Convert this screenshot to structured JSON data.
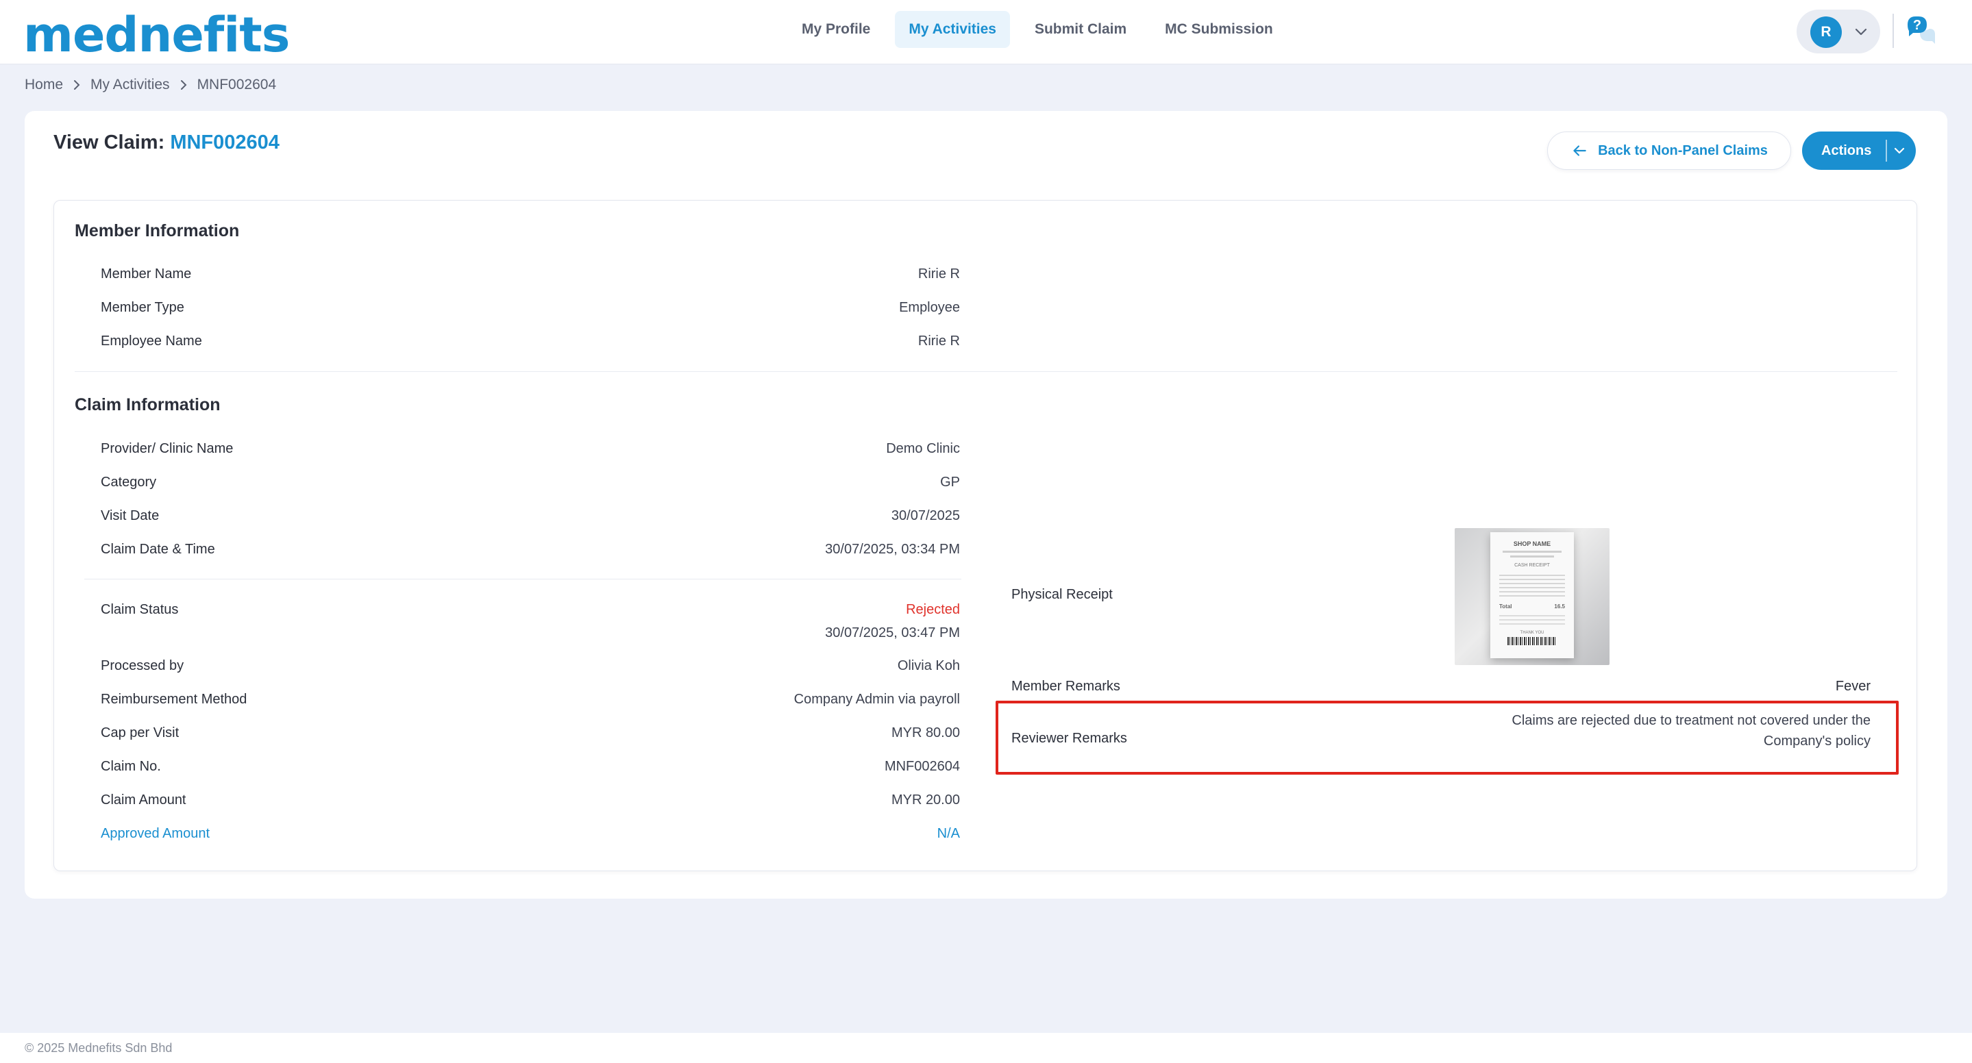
{
  "app": {
    "logo": "mednefits"
  },
  "nav": {
    "items": [
      {
        "label": "My Profile",
        "active": false
      },
      {
        "label": "My Activities",
        "active": true
      },
      {
        "label": "Submit Claim",
        "active": false
      },
      {
        "label": "MC Submission",
        "active": false
      }
    ]
  },
  "user": {
    "initial": "R"
  },
  "breadcrumb": [
    "Home",
    "My Activities",
    "MNF002604"
  ],
  "page": {
    "title_prefix": "View Claim:",
    "claim_id": "MNF002604",
    "back_label": "Back to Non-Panel Claims",
    "actions_label": "Actions"
  },
  "member_info": {
    "title": "Member Information",
    "rows": [
      {
        "label": "Member Name",
        "value": "Ririe R"
      },
      {
        "label": "Member Type",
        "value": "Employee"
      },
      {
        "label": "Employee Name",
        "value": "Ririe R"
      }
    ]
  },
  "claim_info": {
    "title": "Claim Information",
    "rows": [
      {
        "label": "Provider/ Clinic Name",
        "value": "Demo Clinic"
      },
      {
        "label": "Category",
        "value": "GP"
      },
      {
        "label": "Visit Date",
        "value": "30/07/2025"
      },
      {
        "label": "Claim Date & Time",
        "value": "30/07/2025, 03:34 PM"
      }
    ],
    "status": {
      "label": "Claim Status",
      "value": "Rejected",
      "timestamp": "30/07/2025, 03:47 PM"
    },
    "rows2": [
      {
        "label": "Processed by",
        "value": "Olivia Koh"
      },
      {
        "label": "Reimbursement Method",
        "value": "Company Admin via payroll"
      },
      {
        "label": "Cap per Visit",
        "value": "MYR 80.00"
      },
      {
        "label": "Claim No.",
        "value": "MNF002604"
      },
      {
        "label": "Claim Amount",
        "value": "MYR 20.00"
      },
      {
        "label": "Approved Amount",
        "value": "N/A"
      }
    ],
    "receipt_label": "Physical Receipt",
    "receipt_image_text": {
      "shop": "SHOP NAME",
      "heading": "CASH RECEIPT",
      "total": "Total",
      "total_value": "16.5",
      "footer": "THANK YOU"
    },
    "member_remarks_label": "Member Remarks",
    "member_remarks_value": "Fever",
    "reviewer_remarks_label": "Reviewer Remarks",
    "reviewer_remarks_line1": "Claims are rejected due to treatment not covered under the",
    "reviewer_remarks_line2": "Company's policy"
  },
  "colors": {
    "brand": "#1a8fd0",
    "rejected": "#e0322b",
    "highlight": "#e0241c",
    "background": "#eef1f9"
  },
  "footer": {
    "copyright": "© 2025 Mednefits Sdn Bhd"
  }
}
